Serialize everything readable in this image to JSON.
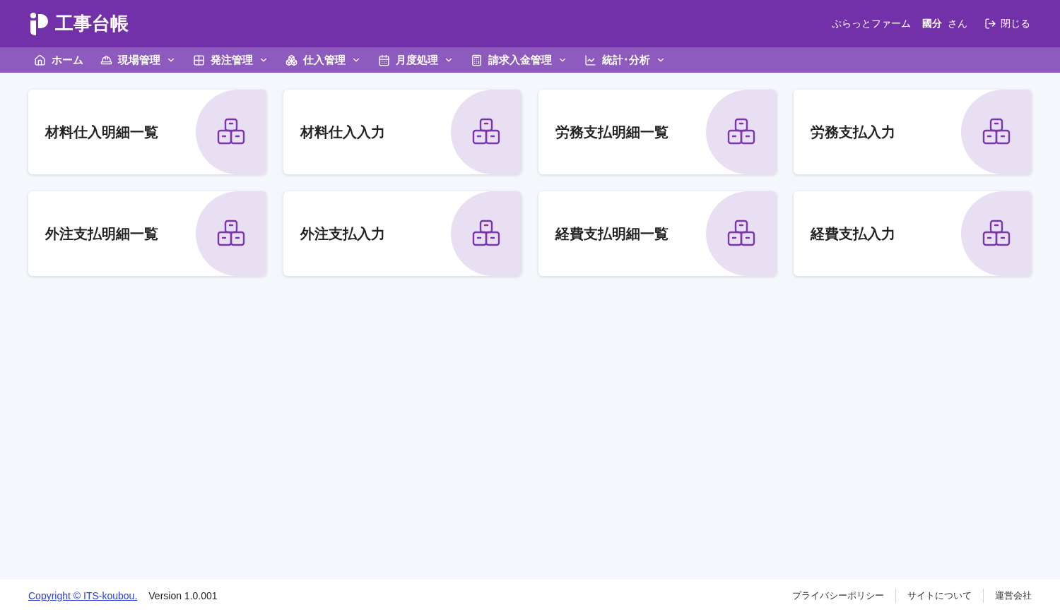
{
  "header": {
    "title": "工事台帳",
    "company": "ぷらっとファーム",
    "user_name": "國分",
    "user_suffix": "さん",
    "logout": "閉じる"
  },
  "nav": [
    {
      "label": "ホーム",
      "kind": "link"
    },
    {
      "label": "現場管理",
      "kind": "menu"
    },
    {
      "label": "発注管理",
      "kind": "menu"
    },
    {
      "label": "仕入管理",
      "kind": "menu"
    },
    {
      "label": "月度処理",
      "kind": "menu"
    },
    {
      "label": "請求入金管理",
      "kind": "menu"
    },
    {
      "label": "統計･分析",
      "kind": "menu"
    }
  ],
  "cards": [
    {
      "label": "材料仕入明細一覧"
    },
    {
      "label": "材料仕入入力"
    },
    {
      "label": "労務支払明細一覧"
    },
    {
      "label": "労務支払入力"
    },
    {
      "label": "外注支払明細一覧"
    },
    {
      "label": "外注支払入力"
    },
    {
      "label": "経費支払明細一覧"
    },
    {
      "label": "経費支払入力"
    }
  ],
  "footer": {
    "copyright": "Copyright © ITS-koubou.",
    "version": "Version 1.0.001",
    "links": [
      "プライバシーポリシー",
      "サイトについて",
      "運営会社"
    ]
  }
}
